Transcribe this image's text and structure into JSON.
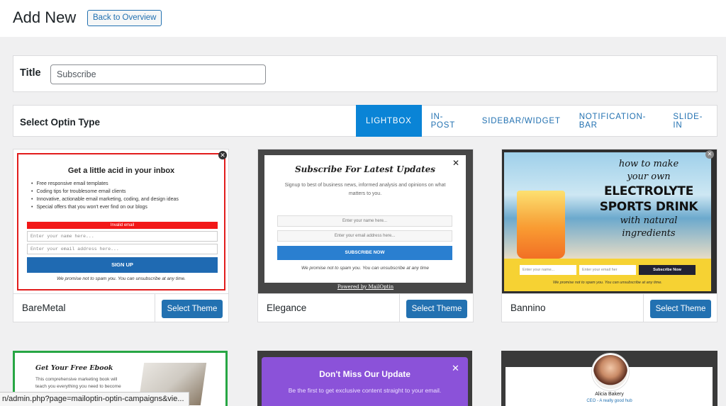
{
  "header": {
    "title": "Add New",
    "back_label": "Back to Overview"
  },
  "title_section": {
    "label": "Title",
    "input_value": "Subscribe"
  },
  "optin_type": {
    "label": "Select Optin Type",
    "tabs": [
      {
        "label": "LIGHTBOX",
        "active": true
      },
      {
        "label": "IN-POST",
        "active": false
      },
      {
        "label": "SIDEBAR/WIDGET",
        "active": false
      },
      {
        "label": "NOTIFICATION-BAR",
        "active": false
      },
      {
        "label": "SLIDE-IN",
        "active": false
      }
    ]
  },
  "themes": [
    {
      "name": "BareMetal",
      "button": "Select Theme",
      "preview": {
        "headline": "Get a little acid in your inbox",
        "bullets": [
          "Free responsive email templates",
          "Coding tips for troublesome email clients",
          "Innovative, actionable email marketing, coding, and design ideas",
          "Special offers that you won't ever find on our blogs"
        ],
        "error": "Invalid email",
        "name_placeholder": "Enter your name here...",
        "email_placeholder": "Enter your email address here...",
        "cta": "SIGN UP",
        "note": "We promise not to spam you. You can unsubscribe at any time."
      }
    },
    {
      "name": "Elegance",
      "button": "Select Theme",
      "preview": {
        "headline": "Subscribe For Latest Updates",
        "subline": "Signup to best of business news, informed analysis and opinions on what matters to you.",
        "name_placeholder": "Enter your name here...",
        "email_placeholder": "Enter your email address here...",
        "cta": "SUBSCRIBE NOW",
        "note": "We promise not to spam you. You can unsubscribe at any time",
        "powered": "Powered by MailOptin"
      }
    },
    {
      "name": "Bannino",
      "button": "Select Theme",
      "preview": {
        "line1": "how to make",
        "line2": "your own",
        "line3": "ELECTROLYTE",
        "line4": "SPORTS DRINK",
        "line5": "with natural",
        "line6": "ingredients",
        "name_placeholder": "Enter your name...",
        "email_placeholder": "Enter your email her",
        "cta": "Subscribe Now",
        "note": "We promise not to spam you. You can unsubscribe at any time."
      }
    }
  ],
  "bottom_previews": {
    "ebook": {
      "headline": "Get Your Free Ebook",
      "sub": "This comprehensive marketing book will teach you everything you need to become"
    },
    "dont_miss": {
      "headline": "Don't Miss Our Update",
      "sub": "Be the first to get exclusive content straight to your email."
    },
    "testimonial": {
      "name": "Alicia Bakery",
      "role": "CEO - A really good hub"
    }
  },
  "status_bar": {
    "url": "n/admin.php?page=mailoptin-optin-campaigns&vie..."
  }
}
